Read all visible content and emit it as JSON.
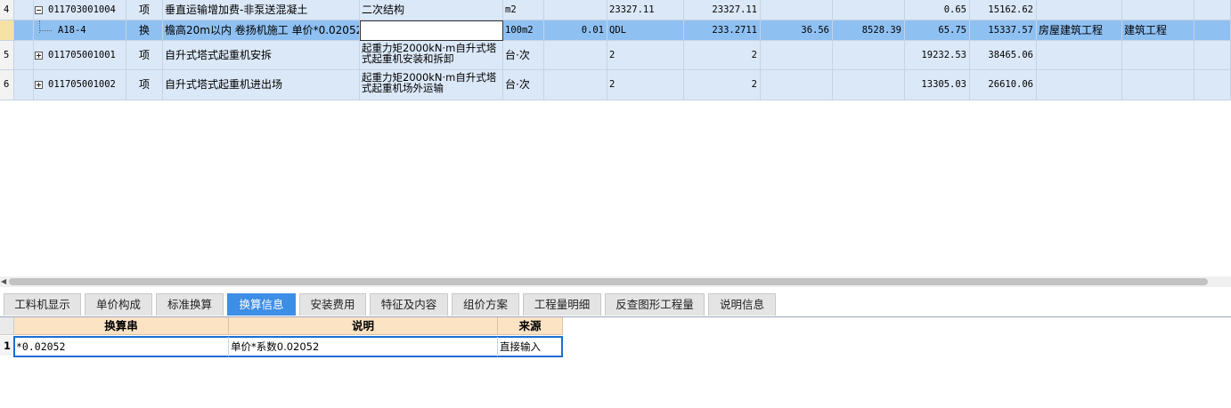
{
  "main_table": {
    "rows": [
      {
        "num": "4",
        "code": "011703001004",
        "type": "项",
        "name": "垂直运输增加费-非泵送混凝土",
        "feature": "二次结构",
        "unit": "m2",
        "c7": "",
        "c8": "23327.11",
        "c9": "23327.11",
        "c10": "",
        "c11": "",
        "c12": "0.65",
        "c13": "15162.62",
        "c14": "",
        "c15": "",
        "expander": "minus"
      },
      {
        "num": "",
        "code": "A18-4",
        "type": "换",
        "name": "檐高20m以内 卷扬机施工  单价*0.02052",
        "feature": "",
        "unit": "100m2",
        "c7": "0.01",
        "c8": "QDL",
        "c9": "233.2711",
        "c10": "36.56",
        "c11": "8528.39",
        "c12": "65.75",
        "c13": "15337.57",
        "c14": "房屋建筑工程",
        "c15": "建筑工程",
        "selected": true
      },
      {
        "num": "5",
        "code": "011705001001",
        "type": "项",
        "name": "自升式塔式起重机安拆",
        "feature": "起重力矩2000kN·m自升式塔式起重机安装和拆卸",
        "unit": "台·次",
        "c7": "",
        "c8": "2",
        "c9": "2",
        "c10": "",
        "c11": "",
        "c12": "19232.53",
        "c13": "38465.06",
        "c14": "",
        "c15": "",
        "expander": "plus"
      },
      {
        "num": "6",
        "code": "011705001002",
        "type": "项",
        "name": "自升式塔式起重机进出场",
        "feature": "起重力矩2000kN·m自升式塔式起重机场外运输",
        "unit": "台·次",
        "c7": "",
        "c8": "2",
        "c9": "2",
        "c10": "",
        "c11": "",
        "c12": "13305.03",
        "c13": "26610.06",
        "c14": "",
        "c15": "",
        "expander": "plus"
      }
    ]
  },
  "tabs": [
    "工料机显示",
    "单价构成",
    "标准换算",
    "换算信息",
    "安装费用",
    "特征及内容",
    "组价方案",
    "工程量明细",
    "反查图形工程量",
    "说明信息"
  ],
  "active_tab": "换算信息",
  "sub_table": {
    "headers": [
      "换算串",
      "说明",
      "来源"
    ],
    "rows": [
      {
        "num": "1",
        "expr": "*0.02052",
        "desc": "单价*系数0.02052",
        "source": "直接输入"
      }
    ]
  },
  "colors": {
    "row_bg": "#dbe8f8",
    "selected_bg": "#8fc0f2",
    "active_tab": "#3d8ee6",
    "header_bg": "#fbe3c4"
  }
}
